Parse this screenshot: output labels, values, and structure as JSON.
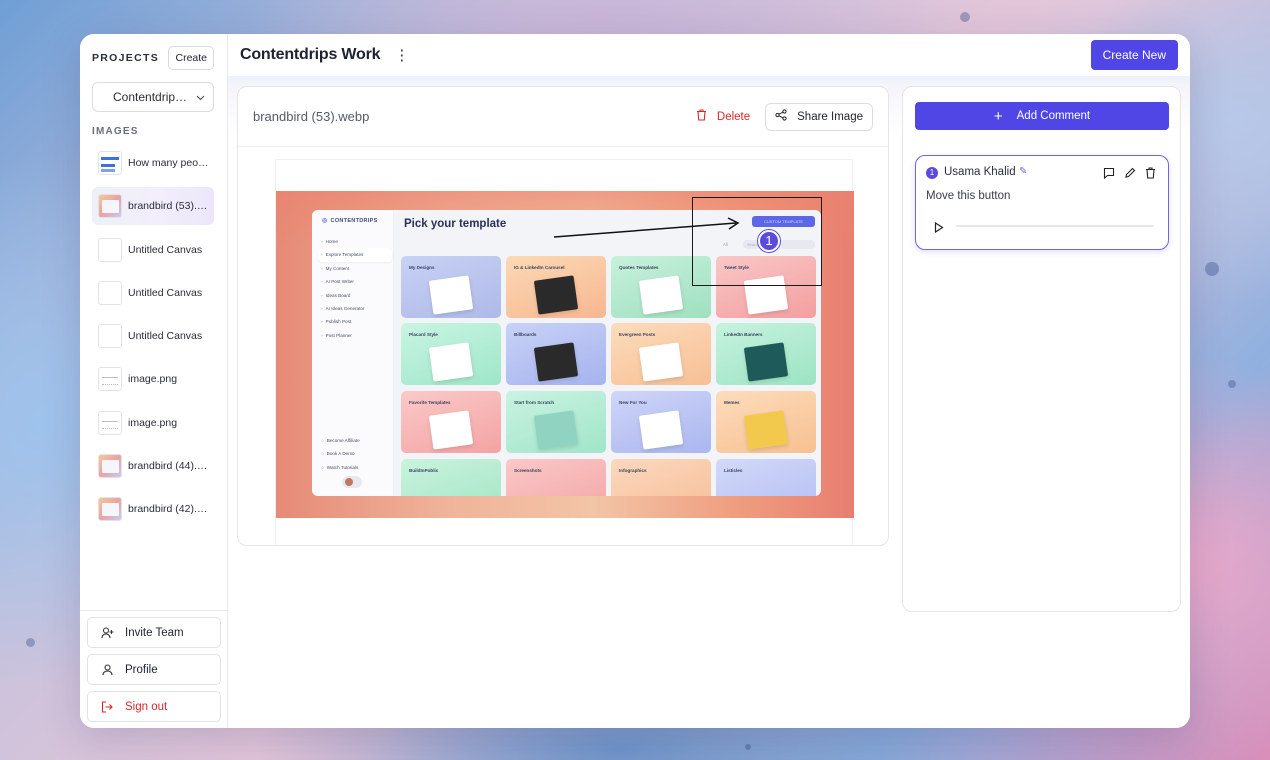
{
  "sidebar": {
    "projects_label": "PROJECTS",
    "create_label": "Create",
    "project_selected": "Contentdrips...",
    "images_label": "IMAGES",
    "images": [
      {
        "name": "How many peop...",
        "thumb": "chart",
        "active": false
      },
      {
        "name": "brandbird (53).w...",
        "thumb": "brand",
        "active": true
      },
      {
        "name": "Untitled Canvas",
        "thumb": "blank",
        "active": false
      },
      {
        "name": "Untitled Canvas",
        "thumb": "blank",
        "active": false
      },
      {
        "name": "Untitled Canvas",
        "thumb": "blank",
        "active": false
      },
      {
        "name": "image.png",
        "thumb": "png",
        "active": false
      },
      {
        "name": "image.png",
        "thumb": "png",
        "active": false
      },
      {
        "name": "brandbird (44).w...",
        "thumb": "brand",
        "active": false
      },
      {
        "name": "brandbird (42).w...",
        "thumb": "brand",
        "active": false
      }
    ],
    "invite_label": "Invite Team",
    "profile_label": "Profile",
    "signout_label": "Sign out"
  },
  "header": {
    "title": "Contentdrips Work",
    "create_new_label": "Create New"
  },
  "viewer": {
    "file_name": "brandbird (53).webp",
    "delete_label": "Delete",
    "share_label": "Share Image",
    "preview": {
      "logo": "CONTENTDRIPS",
      "title": "Pick your template",
      "custom_button": "CUSTOM TEMPLATE",
      "filter_all": "All",
      "search_placeholder": "Search",
      "nav": [
        "Home",
        "Explore Templates",
        "My Content",
        "AI Post Writer",
        "Ideas Board",
        "AI Ideas Generator",
        "Publish Post",
        "Post Planner"
      ],
      "footer": [
        "Become Affiliate",
        "Book A Demo",
        "Watch Tutorials"
      ],
      "cards": [
        "My Designs",
        "IG & LinkedIn Carousel",
        "Quotes Templates",
        "Tweet Style",
        "Placard Style",
        "Billboards",
        "Evergreen Posts",
        "LinkedIn Banners",
        "Favorite Templates",
        "Start from Scratch",
        "New For You",
        "Memes",
        "BuildInPublic",
        "Screenshots",
        "Infographics",
        "Listicles"
      ],
      "annotation_number": "1"
    }
  },
  "comments": {
    "add_label": "Add Comment",
    "items": [
      {
        "number": "1",
        "author": "Usama Khalid",
        "text": "Move this button"
      }
    ]
  },
  "colors": {
    "accent": "#4f46e5",
    "danger": "#d5292b"
  }
}
